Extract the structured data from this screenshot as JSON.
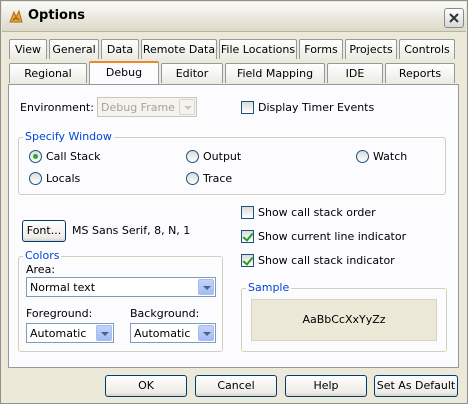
{
  "window": {
    "title": "Options"
  },
  "tabs_row1": [
    {
      "label": "View"
    },
    {
      "label": "General"
    },
    {
      "label": "Data"
    },
    {
      "label": "Remote Data"
    },
    {
      "label": "File Locations"
    },
    {
      "label": "Forms"
    },
    {
      "label": "Projects"
    },
    {
      "label": "Controls"
    }
  ],
  "tabs_row2": [
    {
      "label": "Regional"
    },
    {
      "label": "Debug"
    },
    {
      "label": "Editor"
    },
    {
      "label": "Field Mapping"
    },
    {
      "label": "IDE"
    },
    {
      "label": "Reports"
    }
  ],
  "active_tab": "Debug",
  "debug": {
    "environment_label": "Environment:",
    "environment_value": "Debug Frame",
    "display_timer_events": {
      "label": "Display Timer Events",
      "checked": false
    },
    "specify_window": {
      "title": "Specify Window",
      "options": [
        {
          "label": "Call Stack",
          "selected": true
        },
        {
          "label": "Output",
          "selected": false
        },
        {
          "label": "Watch",
          "selected": false
        },
        {
          "label": "Locals",
          "selected": false
        },
        {
          "label": "Trace",
          "selected": false
        }
      ]
    },
    "font_button": "Font...",
    "font_value": "MS Sans Serif, 8, N, 1",
    "checks": [
      {
        "label": "Show call stack order",
        "checked": false
      },
      {
        "label": "Show current line indicator",
        "checked": true
      },
      {
        "label": "Show call stack indicator",
        "checked": true
      }
    ],
    "colors": {
      "title": "Colors",
      "area_label": "Area:",
      "area_value": "Normal text",
      "foreground_label": "Foreground:",
      "foreground_value": "Automatic",
      "background_label": "Background:",
      "background_value": "Automatic"
    },
    "sample": {
      "title": "Sample",
      "text": "AaBbCcXxYyZz"
    }
  },
  "buttons": {
    "ok": "OK",
    "cancel": "Cancel",
    "help": "Help",
    "set_default": "Set As Default"
  }
}
